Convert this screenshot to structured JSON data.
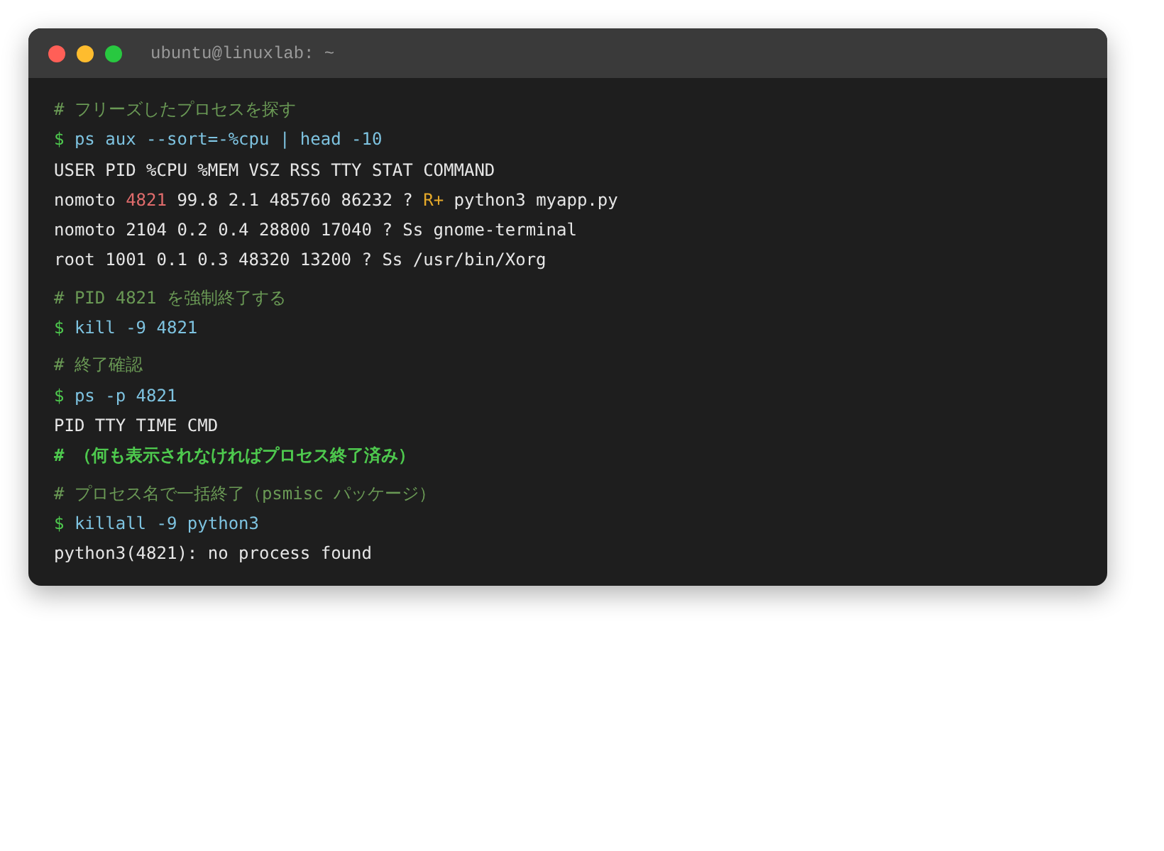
{
  "window": {
    "title": "ubuntu@linuxlab: ~"
  },
  "blocks": [
    [
      {
        "segments": [
          {
            "kind": "comment",
            "text": "# フリーズしたプロセスを探す"
          }
        ]
      },
      {
        "segments": [
          {
            "kind": "prompt",
            "text": "$"
          },
          {
            "kind": "command",
            "text": "ps aux --sort=-%cpu | head -10"
          }
        ]
      },
      {
        "segments": [
          {
            "kind": "output",
            "text": "USER PID %CPU %MEM VSZ RSS TTY STAT COMMAND"
          }
        ]
      },
      {
        "segments": [
          {
            "kind": "output",
            "text": "nomoto"
          },
          {
            "kind": "pid",
            "text": "4821"
          },
          {
            "kind": "output",
            "text": "99.8 2.1 485760 86232 ?"
          },
          {
            "kind": "stat",
            "text": "R+"
          },
          {
            "kind": "output",
            "text": "python3 myapp.py"
          }
        ]
      },
      {
        "segments": [
          {
            "kind": "output",
            "text": "nomoto 2104 0.2 0.4 28800 17040 ? Ss gnome-terminal"
          }
        ]
      },
      {
        "segments": [
          {
            "kind": "output",
            "text": "root 1001 0.1 0.3 48320 13200 ? Ss /usr/bin/Xorg"
          }
        ]
      }
    ],
    [
      {
        "segments": [
          {
            "kind": "comment",
            "text": "# PID 4821 を強制終了する"
          }
        ]
      },
      {
        "segments": [
          {
            "kind": "prompt",
            "text": "$"
          },
          {
            "kind": "command",
            "text": "kill -9 4821"
          }
        ]
      }
    ],
    [
      {
        "segments": [
          {
            "kind": "comment",
            "text": "# 終了確認"
          }
        ]
      },
      {
        "segments": [
          {
            "kind": "prompt",
            "text": "$"
          },
          {
            "kind": "command",
            "text": "ps -p 4821"
          }
        ]
      },
      {
        "segments": [
          {
            "kind": "output",
            "text": "PID TTY TIME CMD"
          }
        ]
      },
      {
        "segments": [
          {
            "kind": "note",
            "text": "# （何も表示されなければプロセス終了済み）"
          }
        ]
      }
    ],
    [
      {
        "segments": [
          {
            "kind": "comment",
            "text": "# プロセス名で一括終了（psmisc パッケージ）"
          }
        ]
      },
      {
        "segments": [
          {
            "kind": "prompt",
            "text": "$"
          },
          {
            "kind": "command",
            "text": "killall -9 python3"
          }
        ]
      },
      {
        "segments": [
          {
            "kind": "output",
            "text": "python3(4821): no process found"
          }
        ]
      }
    ]
  ]
}
